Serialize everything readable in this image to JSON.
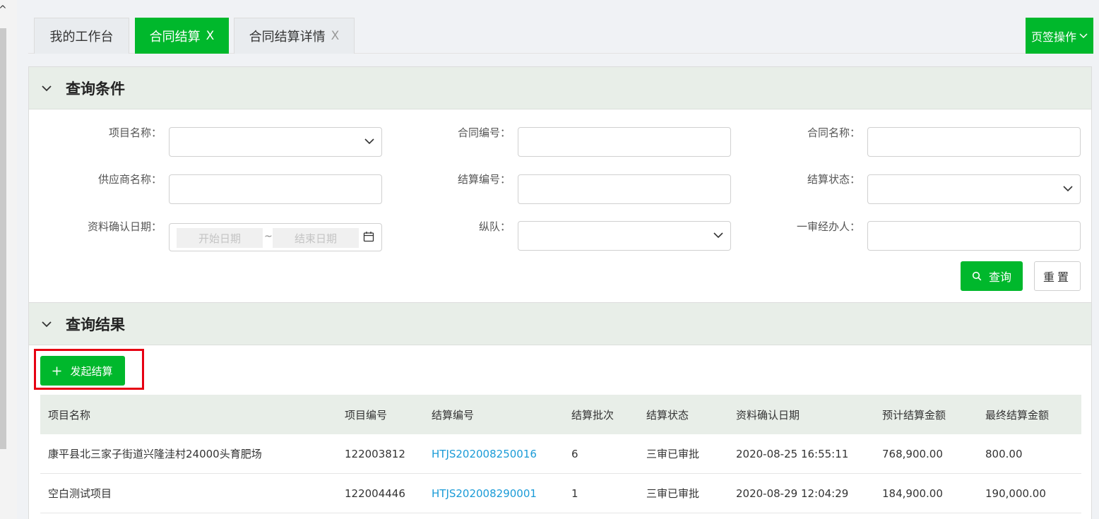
{
  "tabs": [
    {
      "label": "我的工作台",
      "closable": false,
      "active": false
    },
    {
      "label": "合同结算",
      "closable": true,
      "active": true
    },
    {
      "label": "合同结算详情",
      "closable": true,
      "active": false
    }
  ],
  "tab_close_glyph": "X",
  "page_ops_label": "页签操作",
  "query_panel": {
    "title": "查询条件",
    "fields": {
      "project_name": {
        "label": "项目名称：",
        "value": ""
      },
      "contract_no": {
        "label": "合同编号：",
        "value": ""
      },
      "contract_name": {
        "label": "合同名称：",
        "value": ""
      },
      "supplier_name": {
        "label": "供应商名称：",
        "value": ""
      },
      "settlement_no": {
        "label": "结算编号：",
        "value": ""
      },
      "settlement_status": {
        "label": "结算状态：",
        "value": ""
      },
      "confirm_date": {
        "label": "资料确认日期：",
        "start_placeholder": "开始日期",
        "end_placeholder": "结束日期",
        "separator": "~"
      },
      "column_team": {
        "label": "纵队：",
        "value": ""
      },
      "first_reviewer": {
        "label": "一审经办人：",
        "value": ""
      }
    },
    "query_button": "查询",
    "reset_button": "重置"
  },
  "result_panel": {
    "title": "查询结果",
    "start_button": "发起结算",
    "columns": [
      "项目名称",
      "项目编号",
      "结算编号",
      "结算批次",
      "结算状态",
      "资料确认日期",
      "预计结算金额",
      "最终结算金额"
    ],
    "rows": [
      [
        "康平县北三家子街道兴隆洼村24000头育肥场",
        "122003812",
        "HTJS202008250016",
        "6",
        "三审已审批",
        "2020-08-25 16:55:11",
        "768,900.00",
        "800.00"
      ],
      [
        "空白测试项目",
        "122004446",
        "HTJS202008290001",
        "1",
        "三审已审批",
        "2020-08-29 12:04:29",
        "184,900.00",
        "190,000.00"
      ]
    ]
  },
  "colors": {
    "accent": "#00b82c",
    "link": "#1a9bd7",
    "highlight": "#e60012",
    "panel_header": "#e8eee8"
  }
}
